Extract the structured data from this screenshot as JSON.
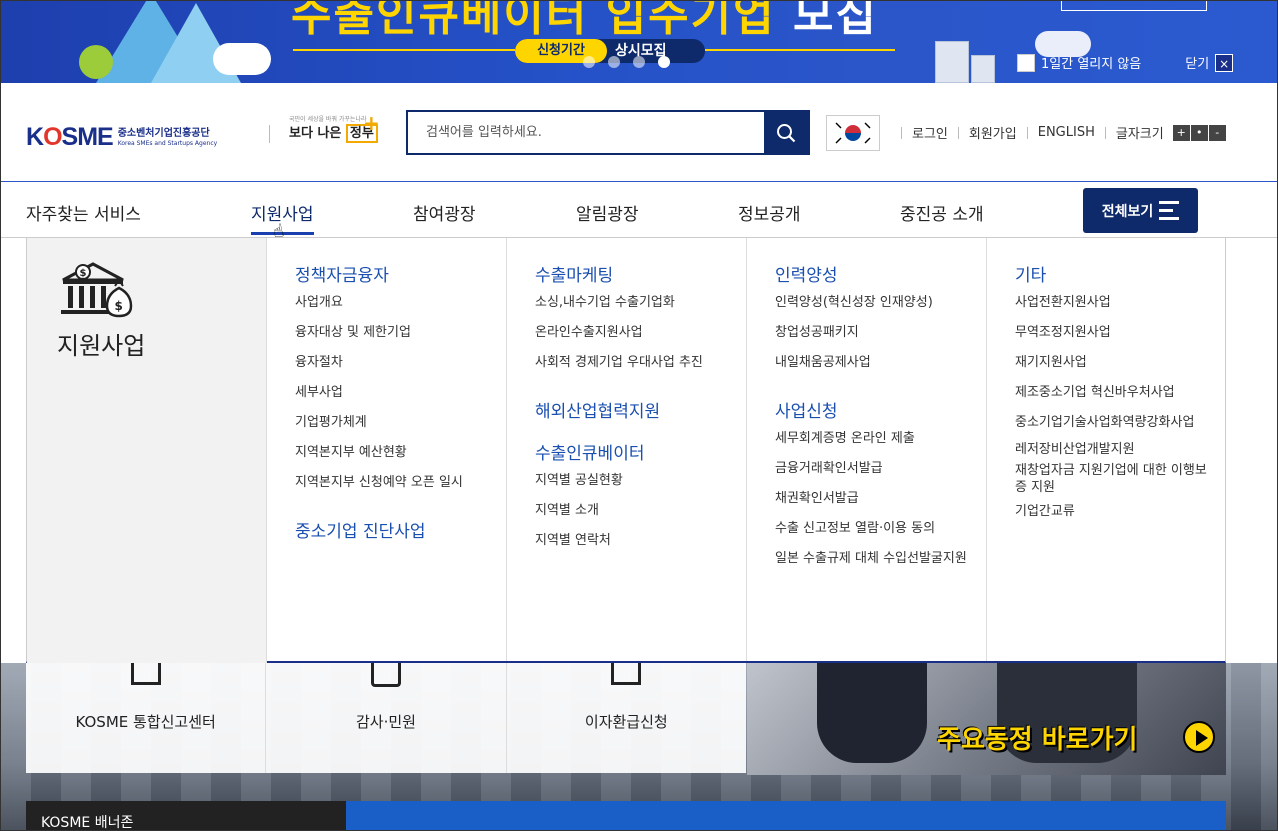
{
  "banner": {
    "title_yellow": "수출인큐베이터 입주기업",
    "title_white": "모집",
    "period_label": "신청기간",
    "period_value": "상시모집",
    "no_show_label": "1일간 열리지 않음",
    "close_label": "닫기",
    "close_icon": "×",
    "slide_dots": 4,
    "active_dot": 4,
    "colors": {
      "bg": "#2552c8",
      "accent": "#ffd500"
    }
  },
  "header": {
    "logo_text_pre": "K",
    "logo_text_o": "O",
    "logo_text_post": "SME",
    "logo_ko": "중소벤처기업진흥공단",
    "logo_en": "Korea SMEs and Startups Agency",
    "gov_small": "국민이 세상을 바꿔 가꾸는나라",
    "gov_big_1": "보다 나은",
    "gov_big_2": "정부",
    "gov_plus": "+",
    "search_placeholder": "검색어를 입력하세요.",
    "flag_icon": "korea-flag",
    "links": [
      "로그인",
      "회원가입",
      "ENGLISH",
      "글자크기"
    ],
    "font_size_buttons": [
      "+",
      "•",
      "-"
    ]
  },
  "gnb": {
    "items": [
      "자주찾는 서비스",
      "지원사업",
      "참여광장",
      "알림광장",
      "정보공개",
      "중진공 소개"
    ],
    "active": "지원사업",
    "all_menu_label": "전체보기"
  },
  "mega": {
    "side_title": "지원사업",
    "columns": [
      {
        "groups": [
          {
            "title": "정책자금융자",
            "items": [
              "사업개요",
              "융자대상 및 제한기업",
              "융자절차",
              "세부사업",
              "기업평가체계",
              "지역본지부 예산현황",
              "지역본지부 신청예약 오픈 일시"
            ]
          },
          {
            "title": "중소기업 진단사업",
            "items": []
          }
        ]
      },
      {
        "groups": [
          {
            "title": "수출마케팅",
            "items": [
              "소싱,내수기업 수출기업화",
              "온라인수출지원사업",
              "사회적 경제기업 우대사업 추진"
            ]
          },
          {
            "title": "해외산업협력지원",
            "items": []
          },
          {
            "title": "수출인큐베이터",
            "items": [
              "지역별 공실현황",
              "지역별 소개",
              "지역별 연락처"
            ]
          }
        ]
      },
      {
        "groups": [
          {
            "title": "인력양성",
            "items": [
              "인력양성(혁신성장 인재양성)",
              "창업성공패키지",
              "내일채움공제사업"
            ]
          },
          {
            "title": "사업신청",
            "items": [
              "세무회계증명 온라인 제출",
              "금융거래확인서발급",
              "채권확인서발급",
              "수출 신고정보 열람·이용 동의",
              "일본 수출규제 대체 수입선발굴지원"
            ]
          }
        ]
      },
      {
        "groups": [
          {
            "title": "기타",
            "items": [
              "사업전환지원사업",
              "무역조정지원사업",
              "재기지원사업",
              "제조중소기업 혁신바우처사업",
              "중소기업기술사업화역량강화사업",
              "레저장비산업개발지원",
              "재창업자금 지원기업에 대한 이행보증 지원",
              "기업간교류"
            ]
          }
        ]
      }
    ]
  },
  "lower": {
    "quick_links": [
      "KOSME 통합신고센터",
      "감사·민원",
      "이자환급신청"
    ],
    "shortcut_label": "주요동정 바로가기",
    "banner_zone_label": "KOSME 배너존"
  }
}
